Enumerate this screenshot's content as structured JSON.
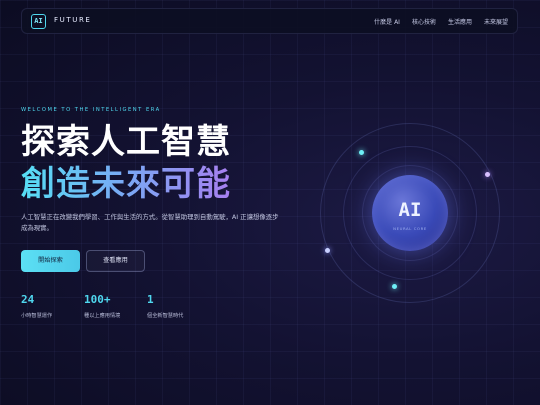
{
  "nav": {
    "logo_mark": "AI",
    "brand": "FUTURE",
    "links": [
      "什麼是 AI",
      "核心技術",
      "生活應用",
      "未來展望"
    ]
  },
  "hero": {
    "eyebrow": "WELCOME TO THE INTELLIGENT ERA",
    "title_line1": "探索人工智慧",
    "title_line2": "創造未來可能",
    "description": "人工智慧正在改變我們學習、工作與生活的方式。從智慧助理到自動駕駛，AI 正讓想像逐步成為現實。",
    "primary_button": "開始探索",
    "secondary_button": "查看應用"
  },
  "stats": [
    {
      "value": "24",
      "label": "小時智慧運作"
    },
    {
      "value": "100+",
      "label": "種以上應用情境"
    },
    {
      "value": "1",
      "label": "個全新智慧時代"
    }
  ],
  "visual": {
    "core_label": "AI",
    "core_sublabel": "NEURAL CORE"
  },
  "colors": {
    "accent_cyan": "#4fd7ee",
    "accent_purple": "#a77ff0",
    "background": "#131232"
  }
}
